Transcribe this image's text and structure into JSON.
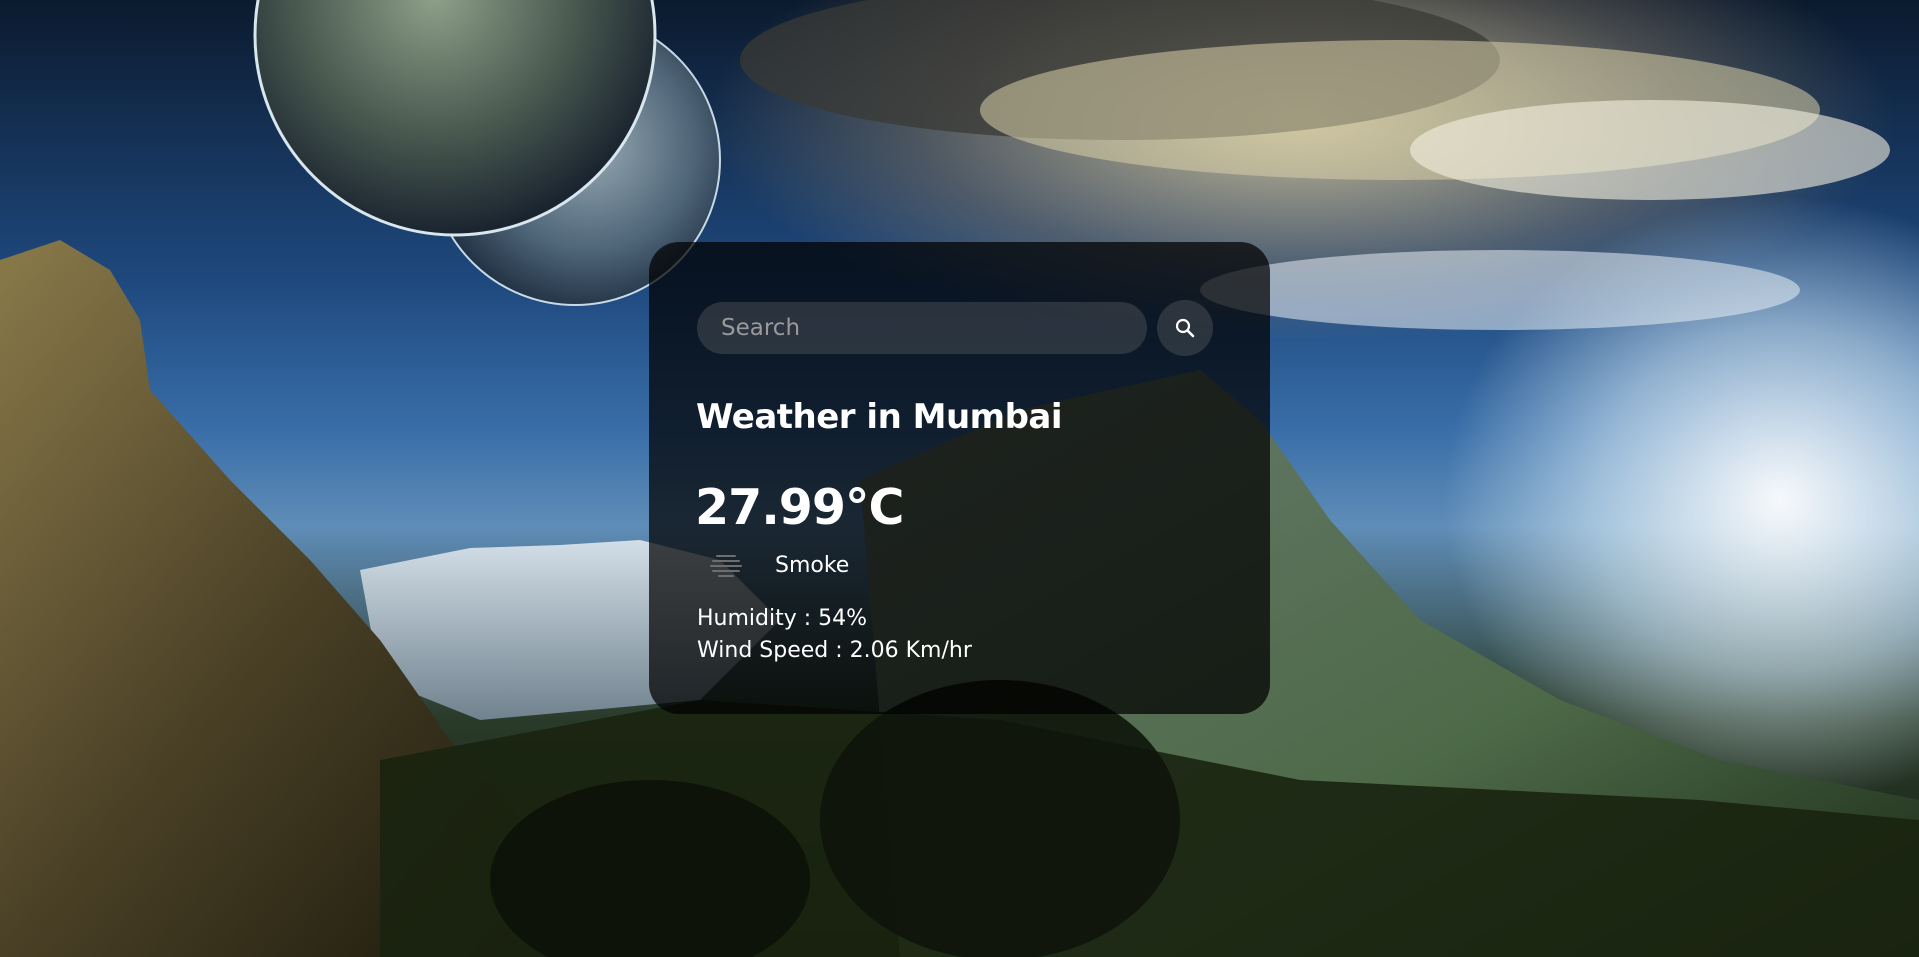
{
  "search": {
    "placeholder": "Search",
    "value": "",
    "button_icon": "search-icon"
  },
  "weather": {
    "city_title": "Weather in Mumbai",
    "temperature": "27.99°C",
    "condition": "Smoke",
    "condition_icon": "smoke-icon",
    "humidity": "Humidity : 54%",
    "wind_speed": "Wind Speed : 2.06 Km/hr"
  },
  "colors": {
    "card_background": "#000000b8",
    "text": "#ffffff",
    "input_background": "#7d7d7d47"
  }
}
